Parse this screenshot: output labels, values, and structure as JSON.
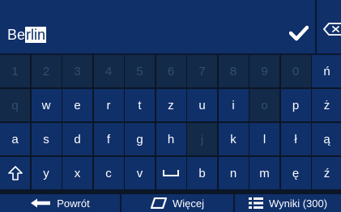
{
  "input": {
    "text_plain": "Be",
    "text_selected": "rlin"
  },
  "icons": {
    "confirm": "check-icon",
    "backspace": "backspace-icon",
    "shift": "shift-arrow-icon",
    "space": "space-bar-icon",
    "back": "left-arrow-icon",
    "more": "parallelogram-icon",
    "results": "list-icon"
  },
  "colors": {
    "background": "#0b1626",
    "key": "#10306a",
    "key_disabled": "#132a48",
    "key_disabled_text": "#2f5075",
    "text": "#ffffff"
  },
  "keyboard": {
    "rows": [
      [
        {
          "label": "1",
          "enabled": false
        },
        {
          "label": "2",
          "enabled": false
        },
        {
          "label": "3",
          "enabled": false
        },
        {
          "label": "4",
          "enabled": false
        },
        {
          "label": "5",
          "enabled": false
        },
        {
          "label": "6",
          "enabled": false
        },
        {
          "label": "7",
          "enabled": false
        },
        {
          "label": "8",
          "enabled": false
        },
        {
          "label": "9",
          "enabled": false
        },
        {
          "label": "0",
          "enabled": false
        },
        {
          "label": "ń",
          "enabled": true
        },
        {
          "label": "ć",
          "enabled": true
        }
      ],
      [
        {
          "label": "q",
          "enabled": false
        },
        {
          "label": "w",
          "enabled": true
        },
        {
          "label": "e",
          "enabled": true
        },
        {
          "label": "r",
          "enabled": true
        },
        {
          "label": "t",
          "enabled": true
        },
        {
          "label": "z",
          "enabled": true
        },
        {
          "label": "u",
          "enabled": true
        },
        {
          "label": "i",
          "enabled": true
        },
        {
          "label": "o",
          "enabled": false
        },
        {
          "label": "p",
          "enabled": true
        },
        {
          "label": "ż",
          "enabled": true
        },
        {
          "label": "ś",
          "enabled": true
        }
      ],
      [
        {
          "label": "a",
          "enabled": true
        },
        {
          "label": "s",
          "enabled": true
        },
        {
          "label": "d",
          "enabled": true
        },
        {
          "label": "f",
          "enabled": true
        },
        {
          "label": "g",
          "enabled": true
        },
        {
          "label": "h",
          "enabled": true
        },
        {
          "label": "j",
          "enabled": false
        },
        {
          "label": "k",
          "enabled": true
        },
        {
          "label": "l",
          "enabled": true
        },
        {
          "label": "ł",
          "enabled": true
        },
        {
          "label": "ą",
          "enabled": true
        },
        {
          "label": "ó",
          "enabled": false
        }
      ],
      [
        {
          "label": "",
          "enabled": true,
          "icon": "shift-arrow-icon"
        },
        {
          "label": "y",
          "enabled": true
        },
        {
          "label": "x",
          "enabled": true
        },
        {
          "label": "c",
          "enabled": true
        },
        {
          "label": "v",
          "enabled": true
        },
        {
          "label": "",
          "enabled": true,
          "icon": "space-bar-icon"
        },
        {
          "label": "b",
          "enabled": true
        },
        {
          "label": "n",
          "enabled": true
        },
        {
          "label": "m",
          "enabled": true
        },
        {
          "label": "ę",
          "enabled": true
        },
        {
          "label": "ź",
          "enabled": true
        },
        {
          "label": "@:",
          "enabled": true
        }
      ]
    ]
  },
  "bottom": {
    "back_label": "Powrót",
    "more_label": "Więcej",
    "results_label": "Wyniki (300)"
  }
}
